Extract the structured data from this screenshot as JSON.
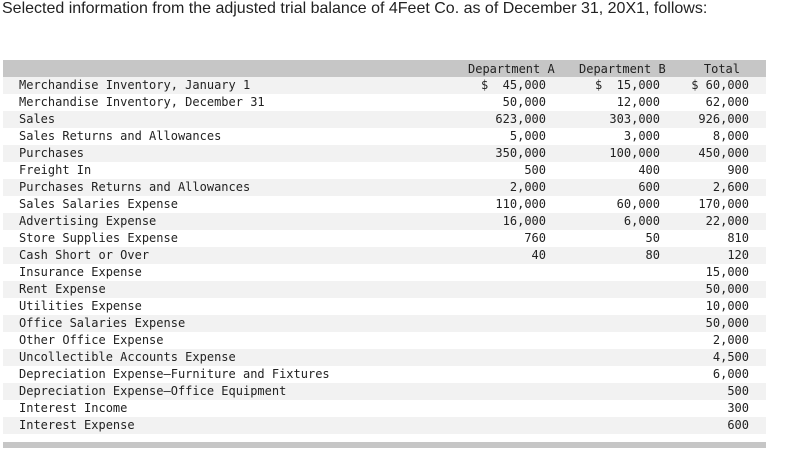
{
  "intro": "Selected information from the adjusted trial balance of 4Feet Co. as of December 31, 20X1, follows:",
  "headers": {
    "dept_a": "Department A",
    "dept_b": "Department B",
    "total": "Total"
  },
  "rows": [
    {
      "label": "Merchandise Inventory, January 1",
      "a": "$  45,000",
      "b": "$  15,000",
      "total": "$ 60,000"
    },
    {
      "label": "Merchandise Inventory, December 31",
      "a": "50,000",
      "b": "12,000",
      "total": "62,000"
    },
    {
      "label": "Sales",
      "a": "623,000",
      "b": "303,000",
      "total": "926,000"
    },
    {
      "label": "Sales Returns and Allowances",
      "a": "5,000",
      "b": "3,000",
      "total": "8,000"
    },
    {
      "label": "Purchases",
      "a": "350,000",
      "b": "100,000",
      "total": "450,000"
    },
    {
      "label": "Freight In",
      "a": "500",
      "b": "400",
      "total": "900"
    },
    {
      "label": "Purchases Returns and Allowances",
      "a": "2,000",
      "b": "600",
      "total": "2,600"
    },
    {
      "label": "Sales Salaries Expense",
      "a": "110,000",
      "b": "60,000",
      "total": "170,000"
    },
    {
      "label": "Advertising Expense",
      "a": "16,000",
      "b": "6,000",
      "total": "22,000"
    },
    {
      "label": "Store Supplies Expense",
      "a": "760",
      "b": "50",
      "total": "810"
    },
    {
      "label": "Cash Short or Over",
      "a": "40",
      "b": "80",
      "total": "120"
    },
    {
      "label": "Insurance Expense",
      "a": "",
      "b": "",
      "total": "15,000"
    },
    {
      "label": "Rent Expense",
      "a": "",
      "b": "",
      "total": "50,000"
    },
    {
      "label": "Utilities Expense",
      "a": "",
      "b": "",
      "total": "10,000"
    },
    {
      "label": "Office Salaries Expense",
      "a": "",
      "b": "",
      "total": "50,000"
    },
    {
      "label": "Other Office Expense",
      "a": "",
      "b": "",
      "total": "2,000"
    },
    {
      "label": "Uncollectible Accounts Expense",
      "a": "",
      "b": "",
      "total": "4,500"
    },
    {
      "label": "Depreciation Expense—Furniture and Fixtures",
      "a": "",
      "b": "",
      "total": "6,000"
    },
    {
      "label": "Depreciation Expense—Office Equipment",
      "a": "",
      "b": "",
      "total": "500"
    },
    {
      "label": "Interest Income",
      "a": "",
      "b": "",
      "total": "300"
    },
    {
      "label": "Interest Expense",
      "a": "",
      "b": "",
      "total": "600"
    }
  ]
}
